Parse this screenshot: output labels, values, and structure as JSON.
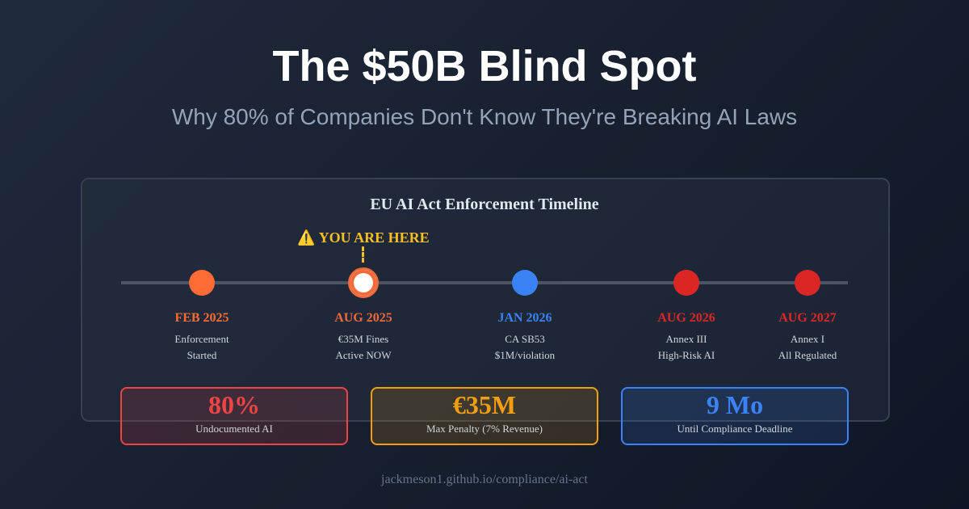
{
  "header": {
    "title": "The $50B Blind Spot",
    "subtitle": "Why 80% of Companies Don't Know They're Breaking AI Laws"
  },
  "timeline": {
    "title": "EU AI Act Enforcement Timeline",
    "marker": {
      "icon": "warning-icon",
      "icon_glyph": "⚠️",
      "label": "YOU ARE HERE",
      "color": "#fbbf24"
    },
    "events": [
      {
        "date": "FEB 2025",
        "line1": "Enforcement",
        "line2": "Started",
        "color": "#ff6b35"
      },
      {
        "date": "AUG 2025",
        "line1": "€35M Fines",
        "line2": "Active NOW",
        "color": "#f26a3a",
        "current": true
      },
      {
        "date": "JAN 2026",
        "line1": "CA SB53",
        "line2": "$1M/violation",
        "color": "#3b82f6"
      },
      {
        "date": "AUG 2026",
        "line1": "Annex III",
        "line2": "High-Risk AI",
        "color": "#dc2626"
      },
      {
        "date": "AUG 2027",
        "line1": "Annex I",
        "line2": "All Regulated",
        "color": "#dc2626"
      }
    ]
  },
  "stats": [
    {
      "value": "80%",
      "label": "Undocumented AI",
      "color": "#ef4444"
    },
    {
      "value": "€35M",
      "label": "Max Penalty (7% Revenue)",
      "color": "#f59e0b"
    },
    {
      "value": "9 Mo",
      "label": "Until Compliance Deadline",
      "color": "#3b82f6"
    }
  ],
  "footer": {
    "url": "jackmeson1.github.io/compliance/ai-act"
  }
}
